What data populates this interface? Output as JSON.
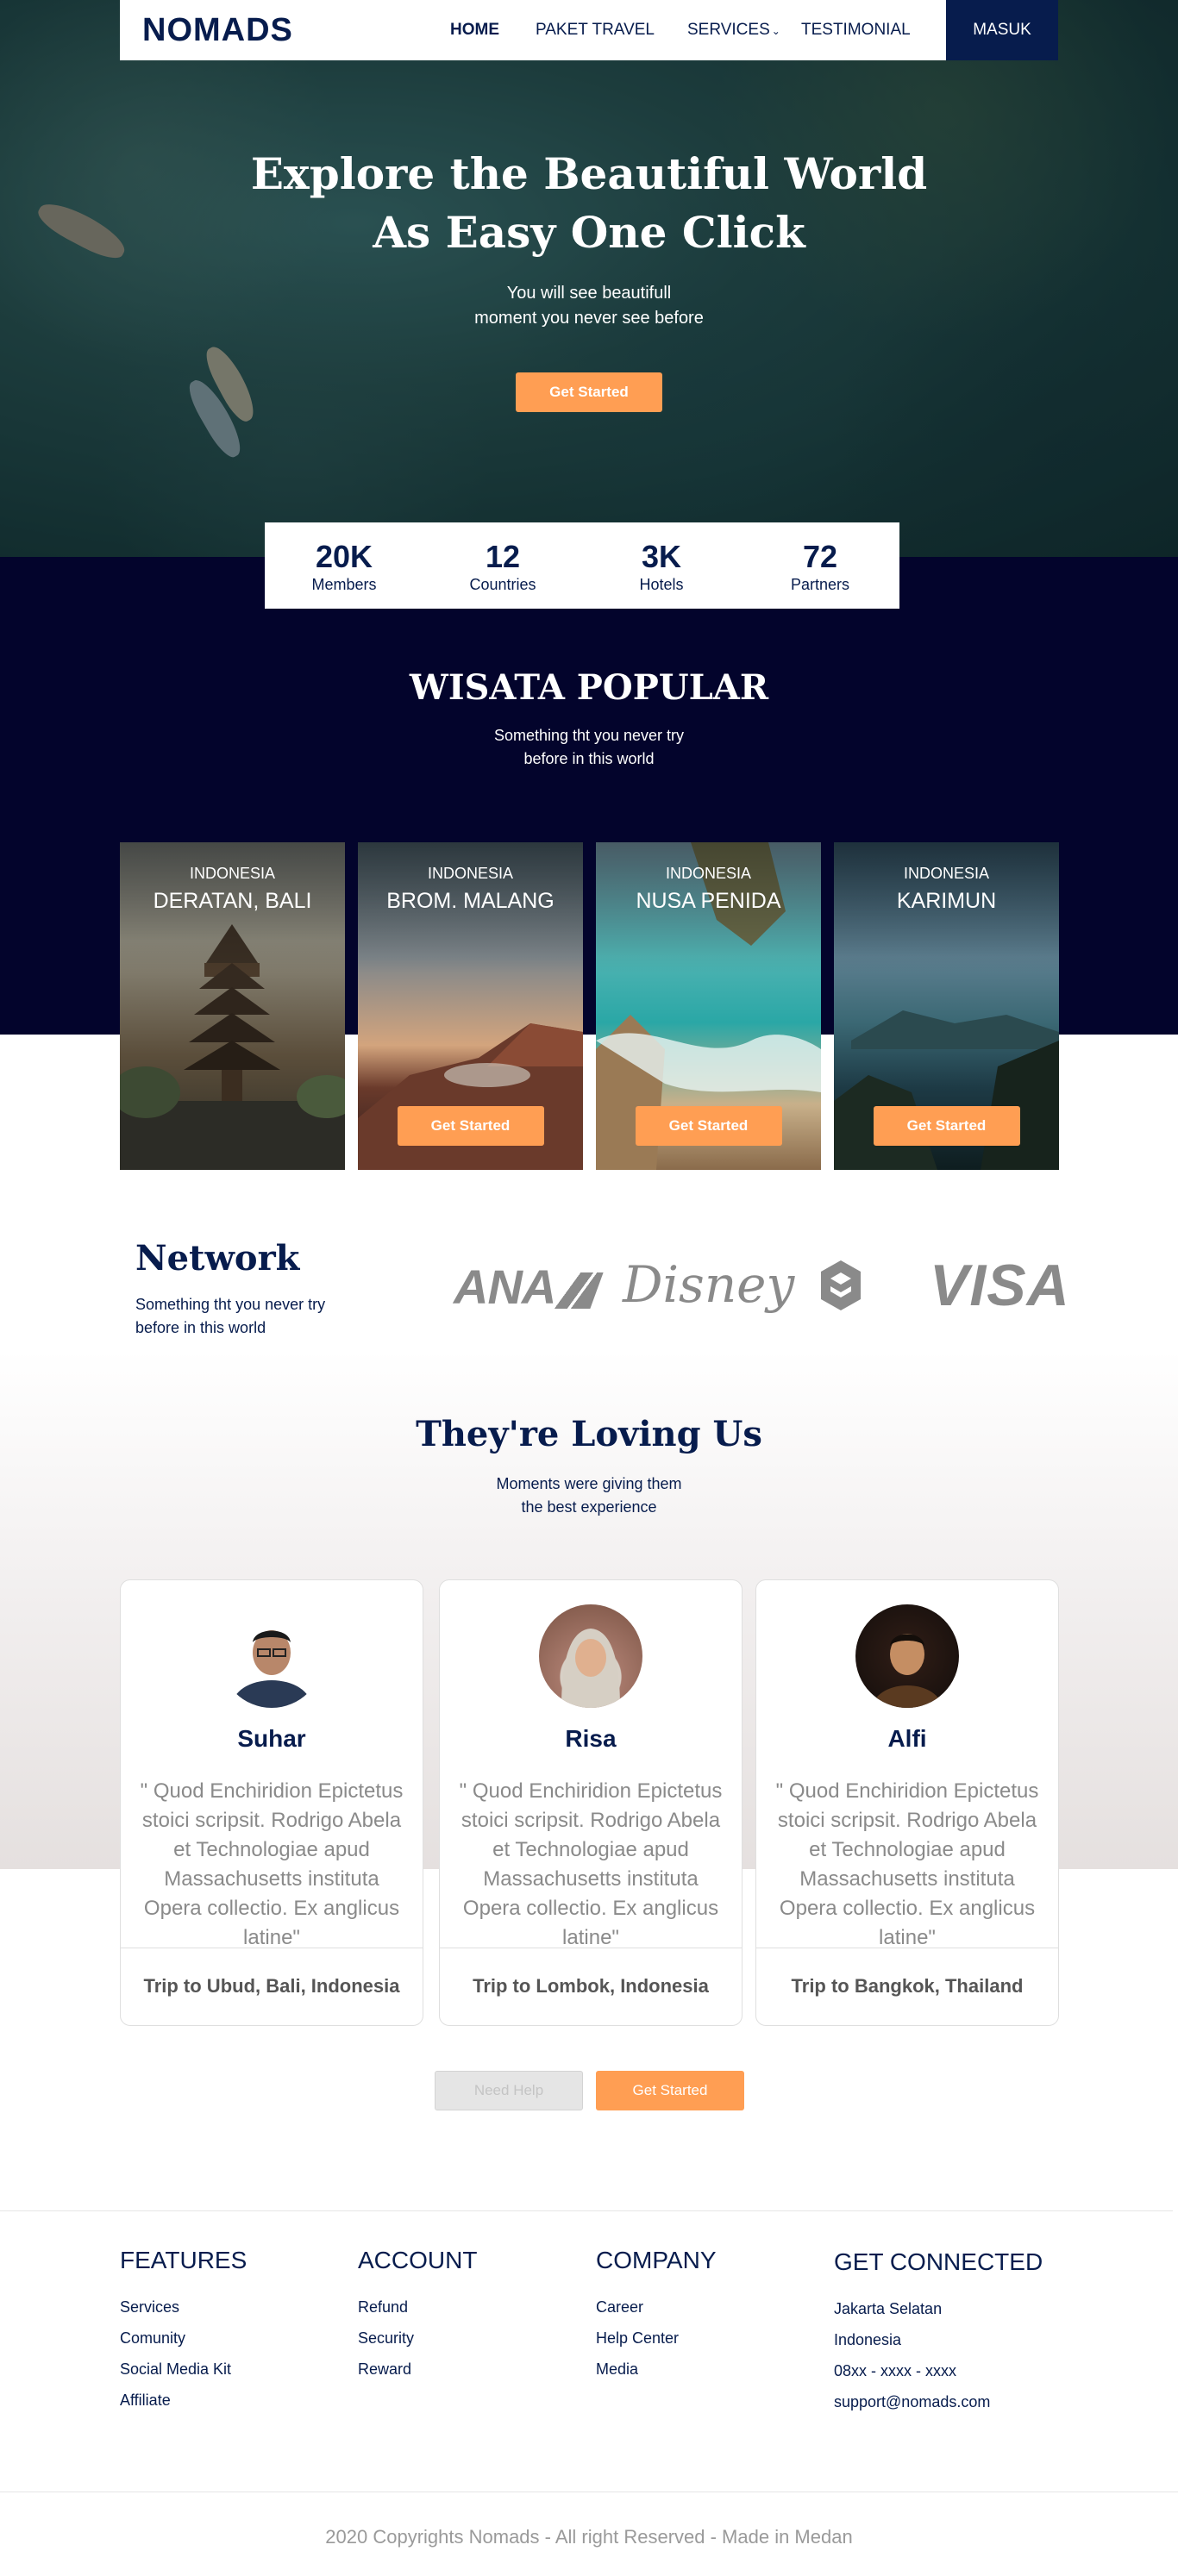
{
  "nav": {
    "logo": "NOMADS",
    "links": [
      "HOME",
      "PAKET TRAVEL",
      "SERVICES",
      "TESTIMONIAL"
    ],
    "login": "MASUK"
  },
  "hero": {
    "title_line1": "Explore the Beautiful World",
    "title_line2": "As Easy One Click",
    "subtitle_line1": "You will see beautifull",
    "subtitle_line2": "moment you never see before",
    "cta": "Get Started"
  },
  "stats": [
    {
      "value": "20K",
      "label": "Members"
    },
    {
      "value": "12",
      "label": "Countries"
    },
    {
      "value": "3K",
      "label": "Hotels"
    },
    {
      "value": "72",
      "label": "Partners"
    }
  ],
  "popular": {
    "title": "WISATA POPULAR",
    "subtitle_line1": "Something tht you never try",
    "subtitle_line2": "before in this world",
    "cards": [
      {
        "country": "INDONESIA",
        "city": "DERATAN, BALI",
        "cta": ""
      },
      {
        "country": "INDONESIA",
        "city": "BROM. MALANG",
        "cta": "Get Started"
      },
      {
        "country": "INDONESIA",
        "city": "NUSA PENIDA",
        "cta": "Get Started"
      },
      {
        "country": "INDONESIA",
        "city": "KARIMUN",
        "cta": "Get Started"
      }
    ]
  },
  "network": {
    "title": "Network",
    "subtitle_line1": "Something tht you never try",
    "subtitle_line2": "before in this world",
    "partners": [
      "ANA",
      "Disney",
      "VISA"
    ]
  },
  "testimonials": {
    "title": "They're Loving Us",
    "subtitle_line1": "Moments were giving them",
    "subtitle_line2": "the best experience",
    "items": [
      {
        "name": "Suhar",
        "quote": "\" Quod Enchiridion Epictetus stoici scripsit. Rodrigo Abela et Technologiae apud Massachusetts instituta Opera collectio. Ex anglicus latine\"",
        "trip": "Trip to Ubud, Bali, Indonesia"
      },
      {
        "name": "Risa",
        "quote": "\" Quod Enchiridion Epictetus stoici scripsit. Rodrigo Abela et Technologiae apud Massachusetts instituta Opera collectio. Ex anglicus latine\"",
        "trip": "Trip to Lombok, Indonesia"
      },
      {
        "name": "Alfi",
        "quote": "\" Quod Enchiridion Epictetus stoici scripsit. Rodrigo Abela et Technologiae apud Massachusetts instituta Opera collectio. Ex anglicus latine\"",
        "trip": "Trip to Bangkok, Thailand"
      }
    ],
    "help_button": "Need Help",
    "cta_button": "Get Started"
  },
  "footer": {
    "features": {
      "title": "FEATURES",
      "items": [
        "Services",
        "Comunity",
        "Social Media Kit",
        "Affiliate"
      ]
    },
    "account": {
      "title": "ACCOUNT",
      "items": [
        "Refund",
        "Security",
        "Reward"
      ]
    },
    "company": {
      "title": "COMPANY",
      "items": [
        "Career",
        "Help Center",
        "Media"
      ]
    },
    "connect": {
      "title": "GET CONNECTED",
      "items": [
        "Jakarta Selatan",
        "Indonesia",
        "08xx - xxxx - xxxx",
        "support@nomads.com"
      ]
    },
    "copyright": "2020 Copyrights Nomads - All right Reserved - Made in Medan"
  },
  "colors": {
    "primary": "#071C4D",
    "accent": "#FF9E53",
    "dark_section": "#03042C"
  }
}
